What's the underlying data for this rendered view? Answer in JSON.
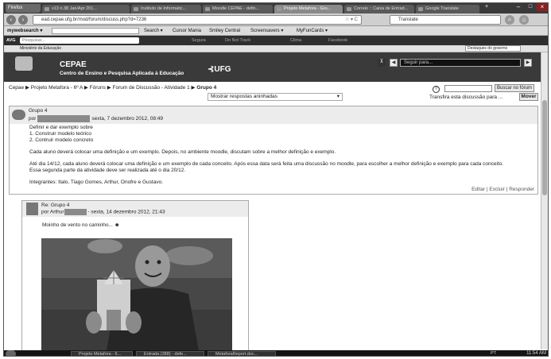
{
  "browser": {
    "app_button": "Firefox",
    "tabs": [
      {
        "label": "v13 n.38 Jan/Apr 201..."
      },
      {
        "label": "Instituto de Informatic..."
      },
      {
        "label": "Moodle CEPAE - defin..."
      },
      {
        "label": "Projeto Metafora - Gru..."
      },
      {
        "label": "Correio :: Caixa de Entrad..."
      },
      {
        "label": "Google Translate"
      }
    ],
    "url": "ead.cepae.ufg.br/mod/forum/discuss.php?d=7236",
    "search_engine": "Translate"
  },
  "toolbar1": {
    "items": [
      "mywebsearch ▾",
      "Search ▾",
      "Cursor Mania",
      "Smiley Central",
      "Screensavers ▾",
      "MyFunCards ▾"
    ]
  },
  "toolbar2": {
    "badge": "AVG",
    "search_placeholder": "Pesquisar...",
    "items": [
      "Segura",
      "Do Not Track",
      "Clima",
      "Facebook"
    ]
  },
  "gov": {
    "left": "Ministério da Educação",
    "right": "Destaques do governo"
  },
  "site": {
    "title": "CEPAE",
    "subtitle": "Centro de Ensino e Pesquisa Aplicada à Educação",
    "university": "UFG",
    "nav_select": "Seguir para..."
  },
  "breadcrumb": [
    "Cepae",
    "Projeto Metafora - 6º A",
    "Fóruns",
    "Forum de Discussão - Atividade 1",
    "Grupo 4"
  ],
  "controls": {
    "display_mode": "Mostrar respostas aninhadas",
    "search_button": "Buscar no fórum",
    "move_label": "Transfira esta discussão para ...",
    "move_button": "Mover"
  },
  "post1": {
    "subject": "Grupo 4",
    "by": "por",
    "date": "sexta, 7 dezembro 2012, 08:49",
    "lines": [
      "Definir e dar exemplo sobre",
      "1. Construir modelo teórico",
      "2. Contruir modelo concreto"
    ],
    "para1": "Cada aluno deverá colocar uma definição e um exemplo. Depois, no ambiente moodle, discutam sobre a melhor definição e exemplo.",
    "para2a": "Até dia 14/12, cada aluno deverá colocar uma definição e um exemplo de cada conceito. Após essa data será feita uma discussão no moodle, para escolher a melhor definição e exemplo para cada conceito.",
    "para2b": "Essa segunda parte da atividade deve ser realizada até o dia 20/12.",
    "members": "Integrantes: Italo, Tiago Gomes, Arthur, Onofre e Gustavo.",
    "links": [
      "Editar",
      "Excluir",
      "Responder"
    ]
  },
  "post2": {
    "subject": "Re: Grupo 4",
    "by": "por",
    "author": "Arthur",
    "date": "- sexta, 14 dezembro 2012, 21:43",
    "text": "Moinho de vento no caminho..."
  },
  "taskbar": {
    "items": [
      "Projeto Metafora - 6...",
      "Entrada (388) - defe...",
      "MetaforaReport.doc..."
    ],
    "tray": "PT",
    "clock": "11:54 AM"
  },
  "colors": {
    "header_bg": "#3a3a3a",
    "page_bg": "#ffffff"
  }
}
